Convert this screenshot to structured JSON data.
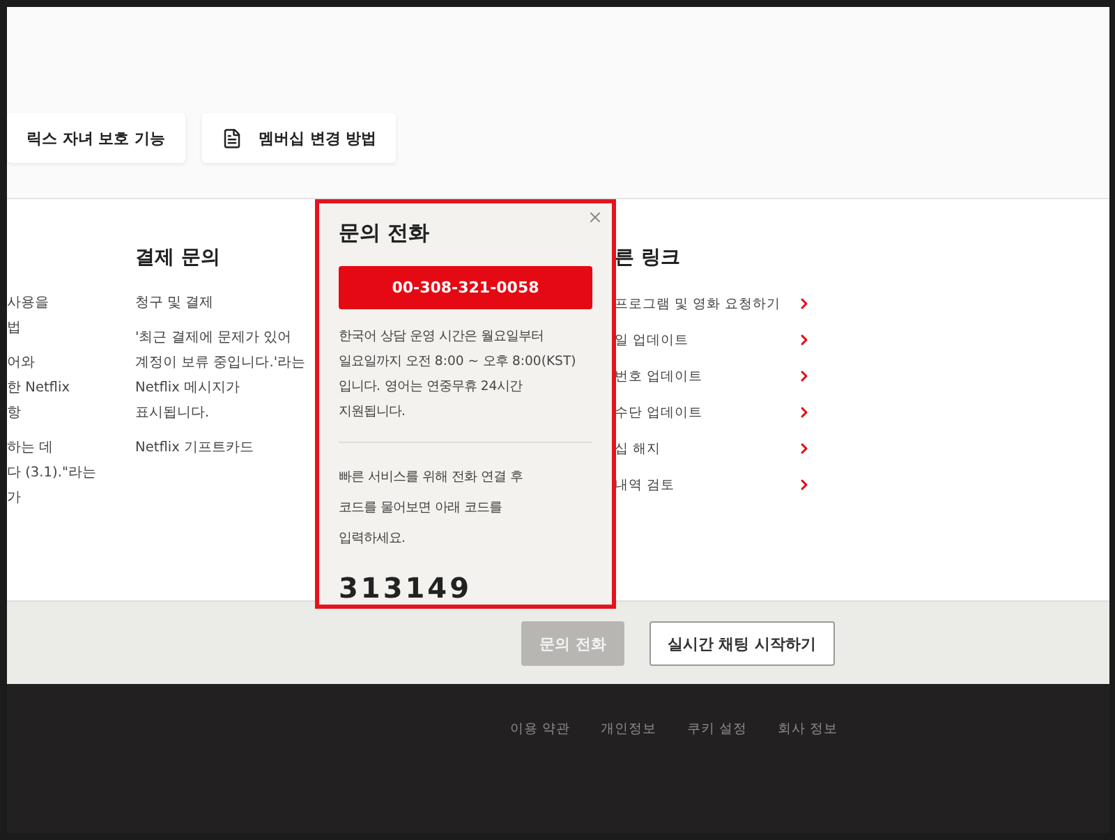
{
  "topic_cards": [
    {
      "kind": "plain",
      "label": "릭스 자녀 보호 기능"
    },
    {
      "kind": "document",
      "label": "멤버십 변경 방법"
    }
  ],
  "columns": [
    {
      "links": [
        "사용을\n법",
        "어와\n한 Netflix\n항",
        "하는 데\n다 (3.1).\"라는\n가"
      ]
    },
    {
      "heading": "결제 문의",
      "links": [
        "청구 및 결제",
        "'최근 결제에 문제가 있어\n계정이 보류 중입니다.'라는\nNetflix 메시지가\n표시됩니다.",
        "Netflix 기프트카드"
      ]
    }
  ],
  "quick_links": {
    "heading": "른 링크",
    "items": [
      "프로그램 및 영화 요청하기",
      "일 업데이트",
      "번호 업데이트",
      "수단 업데이트",
      "십 해지",
      "내역 검토"
    ]
  },
  "call_popup": {
    "title": "문의 전화",
    "phone": "00-308-321-0058",
    "hours": "한국어 상담 운영 시간은 월요일부터\n일요일까지 오전 8:00 ~ 오후 8:00(KST)\n입니다. 영어는 연중무휴 24시간\n지원됩니다.",
    "instructions": "빠른 서비스를 위해 전화 연결 후\n코드를 물어보면 아래 코드를\n입력하세요.",
    "code": "313149"
  },
  "contact_bar": [
    {
      "label": "문의 전화",
      "disabled": true
    },
    {
      "label": "실시간 채팅 시작하기",
      "disabled": false
    }
  ],
  "footer_links": [
    "이용 약관",
    "개인정보",
    "쿠키 설정",
    "회사 정보"
  ]
}
